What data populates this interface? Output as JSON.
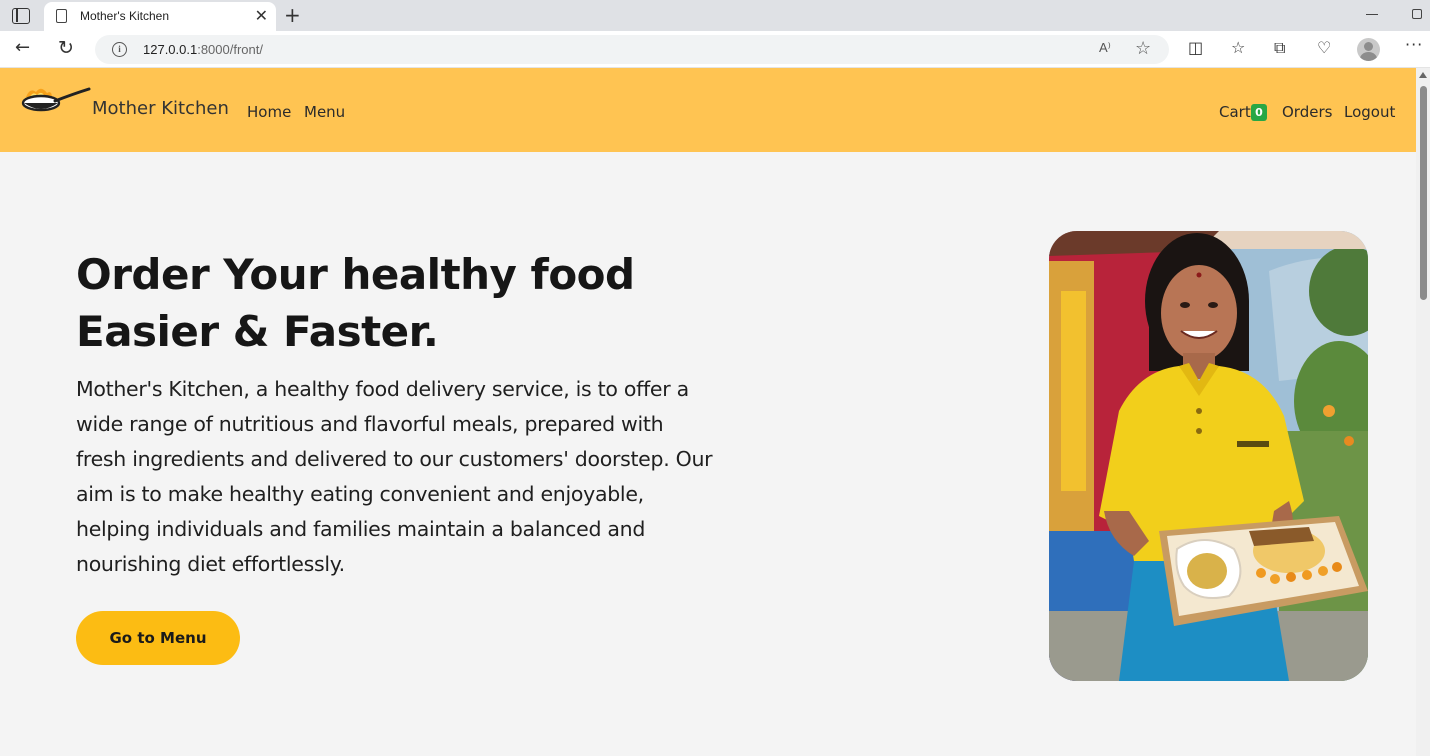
{
  "browser": {
    "tab_title": "Mother's Kitchen",
    "tab_close": "✕",
    "new_tab": "+",
    "url_host": "127.0.0.1",
    "url_path": ":8000/front/",
    "read_aloud": "A⁾"
  },
  "navbar": {
    "brand": "Mother Kitchen",
    "links": {
      "home": "Home",
      "menu": "Menu",
      "cart": "Cart",
      "orders": "Orders",
      "logout": "Logout"
    },
    "cart_count": "0",
    "background_color": "#ffc452",
    "badge_color": "#28a745"
  },
  "hero": {
    "title_line1": "Order Your healthy food",
    "title_line2": "Easier & Faster.",
    "description": "Mother's Kitchen, a healthy food delivery service, is to offer a wide range of nutritious and flavorful meals, prepared with fresh ingredients and delivered to our customers' doorstep. Our aim is to make healthy eating convenient and enjoyable, helping individuals and families maintain a balanced and nourishing diet effortlessly.",
    "cta_label": "Go to Menu",
    "cta_color": "#fcbc13",
    "photo_alt": "Woman in yellow polo shirt holding a tray of food"
  },
  "icons": [
    "window-menu-icon",
    "page-icon",
    "close-icon",
    "plus-icon",
    "back-arrow-icon",
    "reload-icon",
    "info-icon",
    "read-aloud-icon",
    "star-icon",
    "split-screen-icon",
    "favorites-icon",
    "collections-icon",
    "heart-pulse-icon",
    "profile-avatar-icon",
    "more-icon",
    "logo-icon"
  ]
}
